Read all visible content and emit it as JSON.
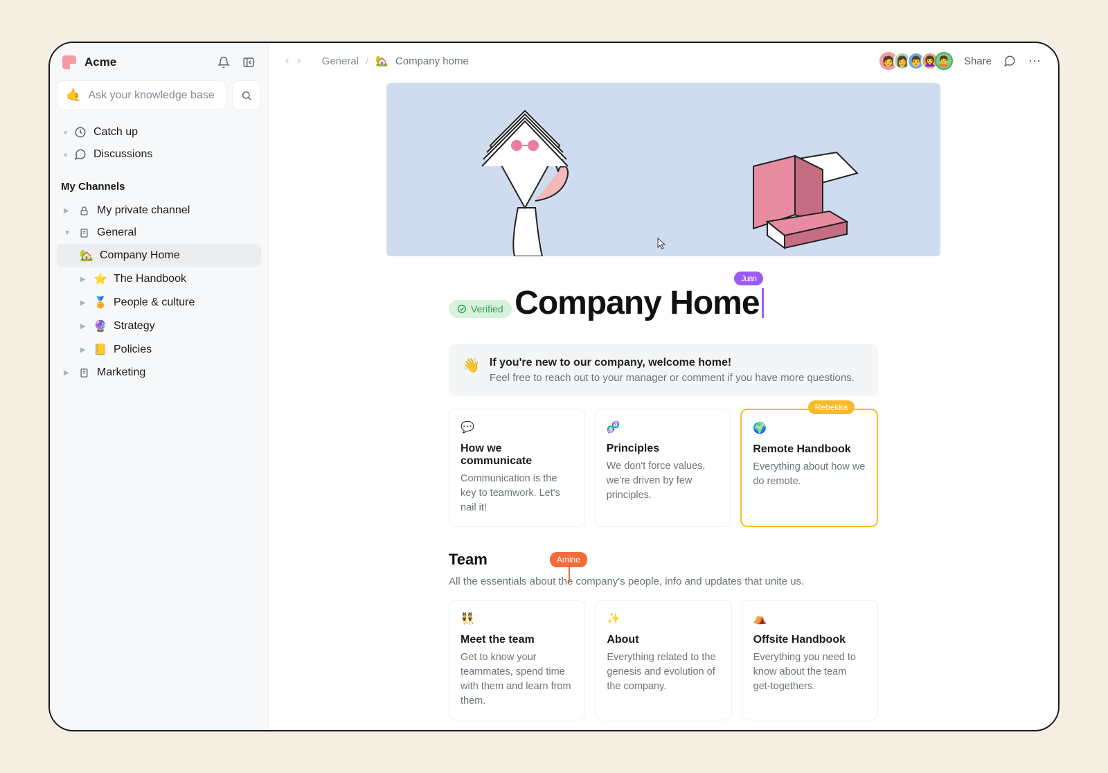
{
  "brand": "Acme",
  "search": {
    "placeholder": "Ask your knowledge base"
  },
  "nav": {
    "catchup": "Catch up",
    "discussions": "Discussions"
  },
  "channels_label": "My Channels",
  "channels": [
    {
      "label": "My private channel",
      "icon": "lock"
    },
    {
      "label": "General",
      "icon": "doc",
      "expanded": true,
      "children": [
        {
          "label": "Company Home",
          "emoji": "🏡",
          "active": true
        },
        {
          "label": "The Handbook",
          "emoji": "⭐"
        },
        {
          "label": "People & culture",
          "emoji": "🏅"
        },
        {
          "label": "Strategy",
          "emoji": "🔮"
        },
        {
          "label": "Policies",
          "emoji": "📒"
        }
      ]
    },
    {
      "label": "Marketing",
      "icon": "doc"
    }
  ],
  "breadcrumb": {
    "parent": "General",
    "emoji": "🏡",
    "current": "Company home"
  },
  "topbar": {
    "share": "Share"
  },
  "verified": "Verified",
  "title": "Company Home",
  "presence": {
    "title": "Juan",
    "card": "Rebekka",
    "section": "Amine"
  },
  "welcome": {
    "emoji": "👋",
    "heading": "If you're new to our company, welcome home!",
    "body": "Feel free to reach out to your manager or comment if you have more questions."
  },
  "cards1": [
    {
      "icon": "💬",
      "title": "How we communicate",
      "body": "Communication is the key to teamwork. Let's nail it!"
    },
    {
      "icon": "🧬",
      "title": "Principles",
      "body": "We don't force values, we're driven by few principles."
    },
    {
      "icon": "🌍",
      "title": "Remote Handbook",
      "body": "Everything about how we do remote."
    }
  ],
  "section2": {
    "heading": "Team",
    "sub": "All the essentials about the company's people, info and updates that unite us."
  },
  "cards2": [
    {
      "icon": "👯",
      "title": "Meet the team",
      "body": "Get to know your teammates, spend time with them and learn from them."
    },
    {
      "icon": "✨",
      "title": "About",
      "body": "Everything related to the genesis and evolution of the company."
    },
    {
      "icon": "⛺",
      "title": "Offsite Handbook",
      "body": "Everything you need to know about the team get-togethers."
    }
  ],
  "avatar_colors": [
    "#f29ba5",
    "#a8d8a8",
    "#6fa8e8",
    "#e8a06f",
    "#7dc98f"
  ]
}
